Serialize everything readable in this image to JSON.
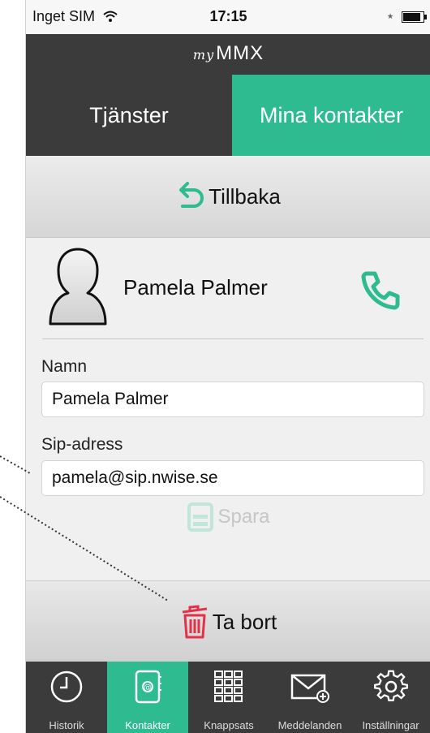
{
  "status": {
    "carrier": "Inget SIM",
    "time": "17:15"
  },
  "app": {
    "logo_small": "my",
    "logo_main": "MMX"
  },
  "tabs": {
    "left": "Tjänster",
    "right": "Mina kontakter"
  },
  "back": {
    "label": "Tillbaka"
  },
  "contact": {
    "name": "Pamela Palmer",
    "name_label": "Namn",
    "name_value": "Pamela Palmer",
    "sip_label": "Sip-adress",
    "sip_value": "pamela@sip.nwise.se"
  },
  "actions": {
    "save_label": "Spara",
    "delete_label": "Ta bort"
  },
  "tabbar": {
    "items": [
      {
        "label": "Historik",
        "icon": "clock-icon"
      },
      {
        "label": "Kontakter",
        "icon": "address-book-icon"
      },
      {
        "label": "Knappsats",
        "icon": "keypad-icon"
      },
      {
        "label": "Meddelanden",
        "icon": "envelope-icon"
      },
      {
        "label": "Inställningar",
        "icon": "gear-icon"
      }
    ],
    "active": "Kontakter"
  },
  "colors": {
    "accent": "#2dbb8f",
    "dark": "#3b3b3b",
    "delete": "#e2324a"
  }
}
